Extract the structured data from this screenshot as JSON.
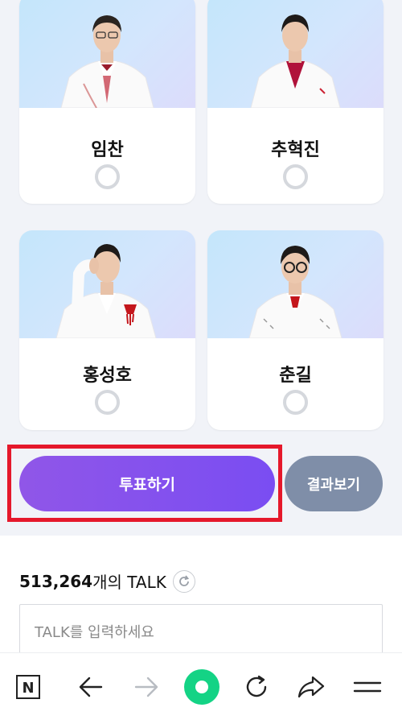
{
  "candidates": [
    {
      "name": "임찬",
      "selected": false
    },
    {
      "name": "추혁진",
      "selected": false
    },
    {
      "name": "홍성호",
      "selected": false
    },
    {
      "name": "춘길",
      "selected": false
    }
  ],
  "actions": {
    "vote_label": "투표하기",
    "result_label": "결과보기"
  },
  "talk": {
    "count": "513,264",
    "count_suffix": "개의 TALK",
    "input_placeholder": "TALK를 입력하세요"
  },
  "browser_bar": {
    "logo_label": "N",
    "icons": [
      "naver-home-icon",
      "back-arrow-icon",
      "forward-arrow-icon",
      "green-dot-icon",
      "refresh-icon",
      "share-icon",
      "menu-icon"
    ]
  },
  "colors": {
    "vote_button": "#8452ee",
    "result_button": "#7f8ea8",
    "highlight_box": "#e5182b",
    "green_dot": "#14d385"
  }
}
